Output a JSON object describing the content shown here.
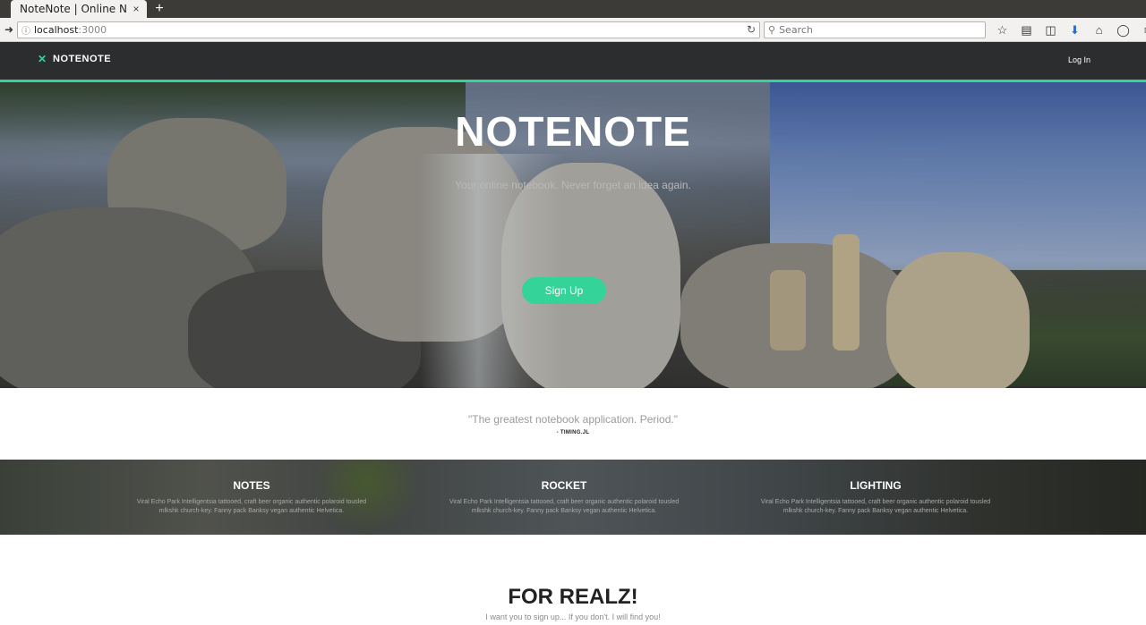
{
  "browser": {
    "tab_title": "NoteNote | Online Not…",
    "tab_close": "×",
    "new_tab": "+",
    "url_host": "localhost",
    "url_port": ":3000",
    "search_placeholder": "Search"
  },
  "header": {
    "brand": "NOTENOTE",
    "login": "Log In"
  },
  "hero": {
    "title": "NOTENOTE",
    "subtitle": "Your online notebook. Never forget an idea again.",
    "signup": "Sign Up"
  },
  "quote": {
    "text": "\"The greatest notebook application. Period.\"",
    "author": "- TIMING.JL"
  },
  "features": [
    {
      "title": "NOTES",
      "text": "Viral Echo Park Intelligentsia tattooed, craft beer organic authentic polaroid tousled mlkshk church-key. Fanny pack Banksy vegan authentic Helvetica."
    },
    {
      "title": "ROCKET",
      "text": "Viral Echo Park Intelligentsia tattooed, craft beer organic authentic polaroid tousled mlkshk church-key. Fanny pack Banksy vegan authentic Helvetica."
    },
    {
      "title": "LIGHTING",
      "text": "Viral Echo Park Intelligentsia tattooed, craft beer organic authentic polaroid tousled mlkshk church-key. Fanny pack Banksy vegan authentic Helvetica."
    }
  ],
  "cta": {
    "title": "FOR REALZ!",
    "subtitle": "I want you to sign up... If you don't.  I will find you!"
  },
  "colors": {
    "accent": "#34d399",
    "header_bg": "#2b2d2f"
  }
}
